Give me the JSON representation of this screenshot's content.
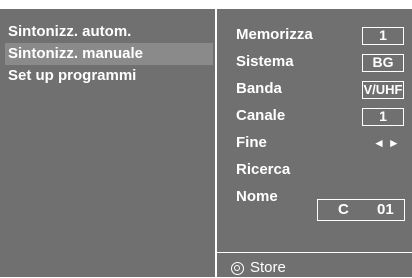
{
  "menu": {
    "items": [
      {
        "label": "Sintonizz. autom.",
        "selected": false
      },
      {
        "label": "Sintonizz. manuale",
        "selected": true
      },
      {
        "label": "Set up programmi",
        "selected": false
      }
    ]
  },
  "settings": {
    "memorizza": {
      "label": "Memorizza",
      "value": "1"
    },
    "sistema": {
      "label": "Sistema",
      "value": "BG"
    },
    "banda": {
      "label": "Banda",
      "value": "V/UHF"
    },
    "canale": {
      "label": "Canale",
      "value": "1"
    },
    "fine": {
      "label": "Fine",
      "arrows": "◄►"
    },
    "ricerca": {
      "label": "Ricerca"
    },
    "nome": {
      "label": "Nome",
      "prefix": "C",
      "number": "01"
    }
  },
  "footer": {
    "store_label": "Store",
    "icon": "store-button-icon"
  },
  "colors": {
    "background": "#707070",
    "selected_bg": "#8a8a8a",
    "text": "#ffffff"
  }
}
